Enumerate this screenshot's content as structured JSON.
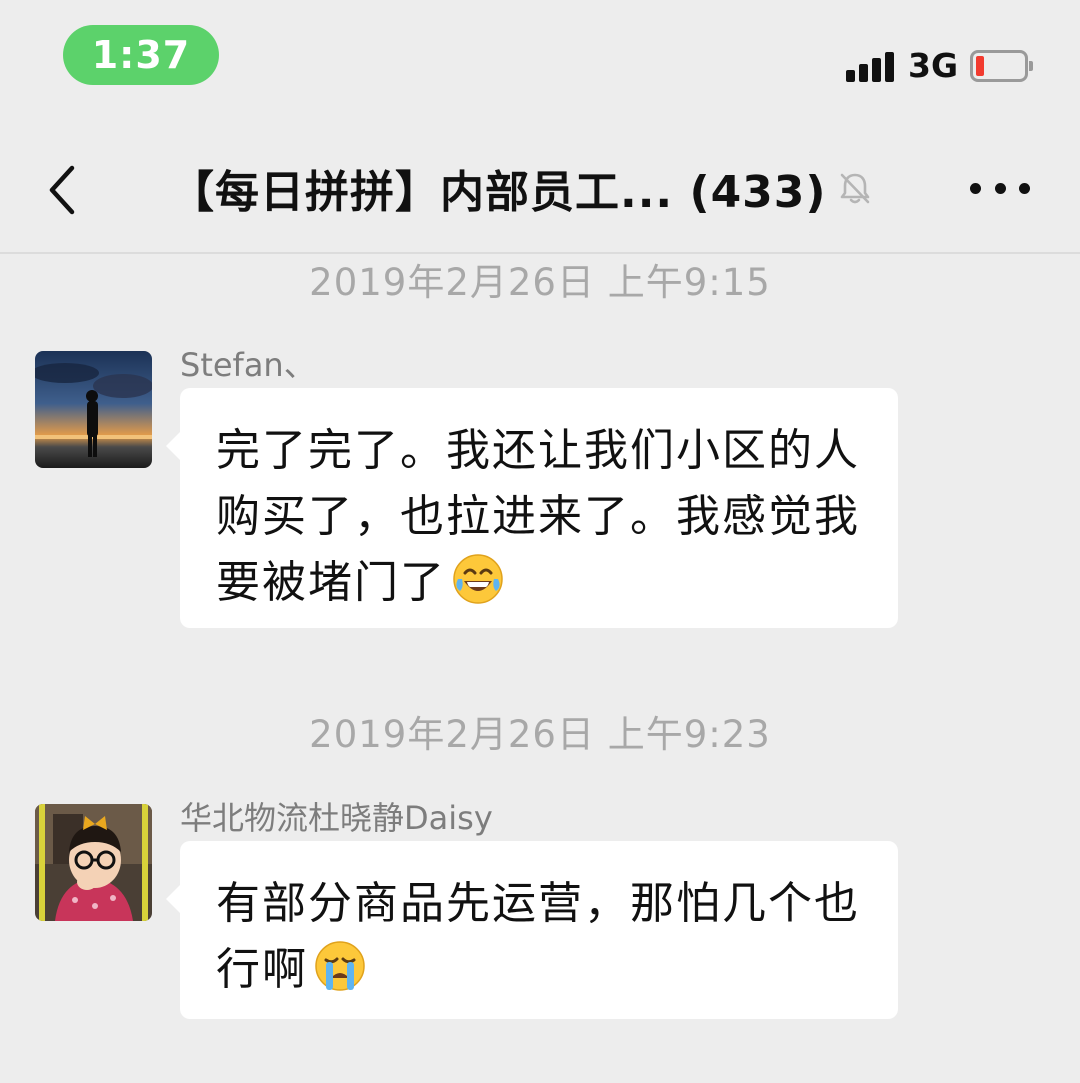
{
  "status_bar": {
    "time": "1:37",
    "network": "3G"
  },
  "nav": {
    "title": "【每日拼拼】内部员工... (433)",
    "back_icon": "chevron-left-icon",
    "mute_icon": "bell-muted-icon",
    "more_icon": "more-dots-icon"
  },
  "messages": [
    {
      "timestamp": "2019年2月26日 上午9:15",
      "sender": "Stefan、",
      "text": "完了完了。我还让我们小区的人购买了，也拉进来了。我感觉我要被堵门了",
      "emoji": "tears-of-joy-emoji"
    },
    {
      "timestamp": "2019年2月26日 上午9:23",
      "sender": "华北物流杜晓静Daisy",
      "text": "有部分商品先运营，那怕几个也行啊",
      "emoji": "crying-emoji"
    }
  ],
  "colors": {
    "background": "#ededed",
    "time_pill": "#5cd26b",
    "battery_low": "#f23b2f",
    "bubble": "#ffffff",
    "timestamp_text": "#a8a8a8"
  }
}
